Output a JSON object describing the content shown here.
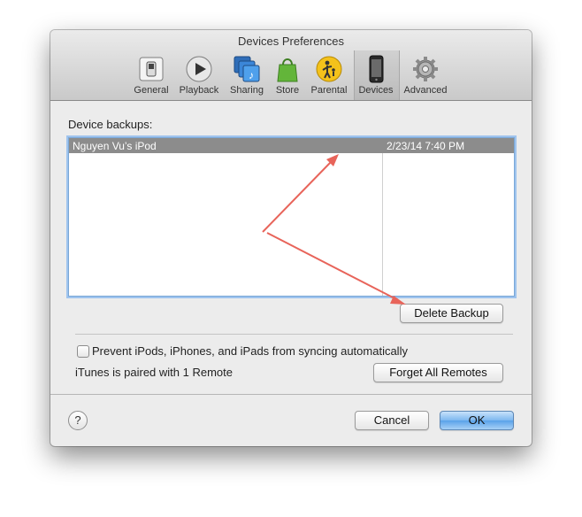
{
  "window": {
    "title": "Devices Preferences"
  },
  "toolbar": {
    "items": [
      {
        "label": "General",
        "icon": "general-switch-icon"
      },
      {
        "label": "Playback",
        "icon": "play-icon"
      },
      {
        "label": "Sharing",
        "icon": "sharing-icon"
      },
      {
        "label": "Store",
        "icon": "shopping-bag-icon"
      },
      {
        "label": "Parental",
        "icon": "parental-icon"
      },
      {
        "label": "Devices",
        "icon": "iphone-icon",
        "selected": true
      },
      {
        "label": "Advanced",
        "icon": "gear-icon"
      }
    ]
  },
  "backups": {
    "label": "Device backups:",
    "rows": [
      {
        "name": "Nguyen Vu’s iPod",
        "date": "2/23/14 7:40 PM"
      }
    ],
    "delete_label": "Delete Backup"
  },
  "options": {
    "prevent_sync_label": "Prevent iPods, iPhones, and iPads from syncing automatically",
    "prevent_sync_checked": false,
    "paired_text": "iTunes is paired with 1 Remote",
    "forget_label": "Forget All Remotes"
  },
  "footer": {
    "help_label": "?",
    "cancel_label": "Cancel",
    "ok_label": "OK"
  },
  "annotation": {
    "arrow_color": "#e8645a"
  }
}
